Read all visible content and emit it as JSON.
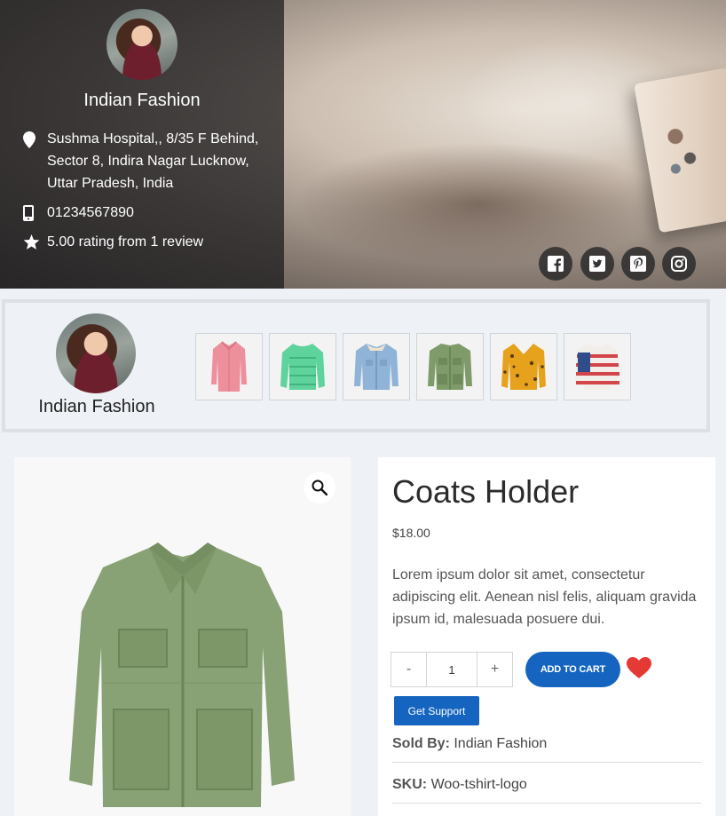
{
  "store": {
    "name": "Indian Fashion",
    "address": "Sushma Hospital,, 8/35 F Behind, Sector 8, Indira Nagar Lucknow, Uttar Pradesh, India",
    "phone": "01234567890",
    "rating_text": "5.00 rating from 1 review",
    "social": [
      "facebook-icon",
      "twitter-icon",
      "pinterest-icon",
      "instagram-icon"
    ]
  },
  "vendor_strip": {
    "name": "Indian Fashion",
    "thumbnails": [
      "pink-shirt",
      "green-sweater",
      "denim-jacket",
      "green-jacket",
      "yellow-cardigan",
      "flag-sweater"
    ]
  },
  "product": {
    "title": "Coats Holder",
    "price": "$18.00",
    "description": "Lorem ipsum dolor sit amet, consectetur adipiscing elit. Aenean nisl felis, aliquam gravida ipsum id, malesuada posuere dui.",
    "quantity": "1",
    "minus_label": "-",
    "plus_label": "+",
    "add_to_cart_label": "ADD TO CART",
    "support_label": "Get Support",
    "sold_by_label": "Sold By:",
    "sold_by_value": "Indian Fashion",
    "sku_label": "SKU:",
    "sku_value": "Woo-tshirt-logo"
  },
  "colors": {
    "primary": "#1565c0",
    "heart": "#e53935",
    "page_bg": "#eef2f6"
  }
}
